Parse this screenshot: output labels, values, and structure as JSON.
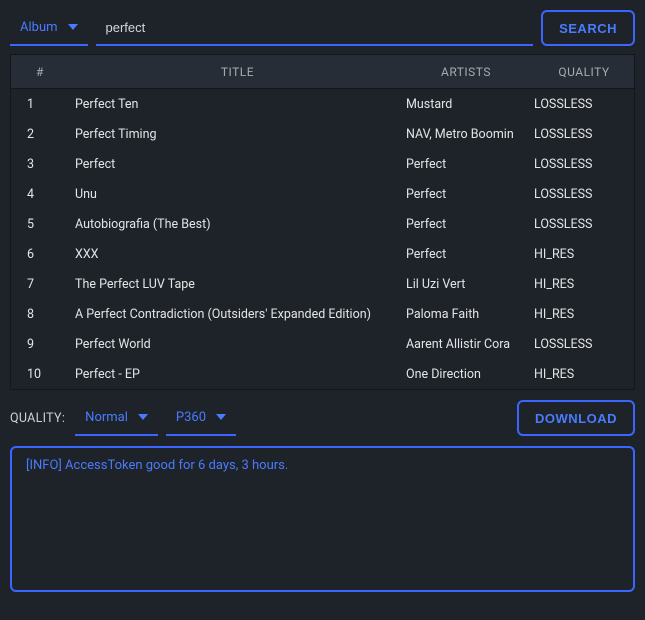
{
  "topbar": {
    "type_select": "Album",
    "search_value": "perfect",
    "search_button": "SEARCH"
  },
  "table": {
    "headers": {
      "n": "#",
      "title": "TITLE",
      "artists": "ARTISTS",
      "quality": "QUALITY"
    },
    "rows": [
      {
        "n": "1",
        "title": "Perfect Ten",
        "artists": "Mustard",
        "quality": "LOSSLESS"
      },
      {
        "n": "2",
        "title": "Perfect Timing",
        "artists": "NAV, Metro Boomin",
        "quality": "LOSSLESS"
      },
      {
        "n": "3",
        "title": "Perfect",
        "artists": "Perfect",
        "quality": "LOSSLESS"
      },
      {
        "n": "4",
        "title": "Unu",
        "artists": "Perfect",
        "quality": "LOSSLESS"
      },
      {
        "n": "5",
        "title": "Autobiografia (The Best)",
        "artists": "Perfect",
        "quality": "LOSSLESS"
      },
      {
        "n": "6",
        "title": "XXX",
        "artists": "Perfect",
        "quality": "HI_RES"
      },
      {
        "n": "7",
        "title": "The Perfect LUV Tape",
        "artists": "Lil Uzi Vert",
        "quality": "HI_RES"
      },
      {
        "n": "8",
        "title": "A Perfect Contradiction (Outsiders' Expanded Edition)",
        "artists": "Paloma Faith",
        "quality": "HI_RES"
      },
      {
        "n": "9",
        "title": "Perfect World",
        "artists": "Aarent Allistir Cora",
        "quality": "LOSSLESS"
      },
      {
        "n": "10",
        "title": "Perfect - EP",
        "artists": "One Direction",
        "quality": "HI_RES"
      }
    ]
  },
  "controls": {
    "quality_label": "QUALITY:",
    "quality_value": "Normal",
    "resolution_value": "P360",
    "download_button": "DOWNLOAD"
  },
  "log": {
    "line1": "[INFO] AccessToken good for 6 days, 3 hours."
  }
}
